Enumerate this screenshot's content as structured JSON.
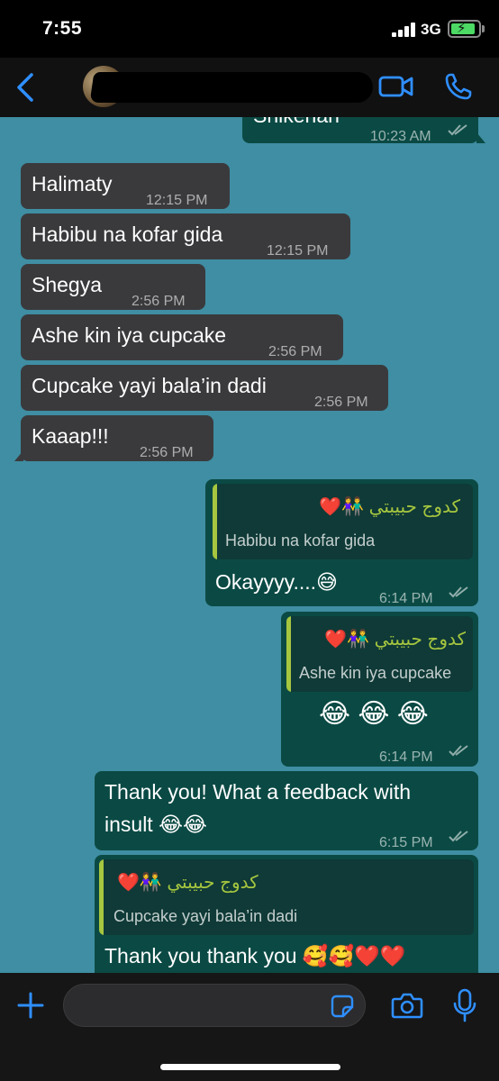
{
  "status_bar": {
    "time": "7:55",
    "network": "3G"
  },
  "colors": {
    "chat_bg": "#3f8ea3",
    "incoming": "#3a3a3d",
    "outgoing": "#0b4a44",
    "accent": "#2f8fff",
    "quote_author": "#a6c63f"
  },
  "nav": {
    "contact_name_redacted": true
  },
  "messages": [
    {
      "direction": "out",
      "text": "Shikenan",
      "time": "10:23 AM",
      "ticks": "read"
    },
    {
      "direction": "in",
      "text": "Halimaty",
      "time": "12:15 PM"
    },
    {
      "direction": "in",
      "text": "Habibu na kofar gida",
      "time": "12:15 PM"
    },
    {
      "direction": "in",
      "text": "Shegya",
      "time": "2:56 PM"
    },
    {
      "direction": "in",
      "text": "Ashe kin iya cupcake",
      "time": "2:56 PM"
    },
    {
      "direction": "in",
      "text": "Cupcake yayi bala’in dadi",
      "time": "2:56 PM"
    },
    {
      "direction": "in",
      "text": "Kaaap!!!",
      "time": "2:56 PM"
    },
    {
      "direction": "out",
      "quote_author": "كدوج حبيبتي 👫❤️",
      "quote_text": "Habibu na kofar gida",
      "text": "Okayyyy....😅",
      "time": "6:14 PM",
      "ticks": "read"
    },
    {
      "direction": "out",
      "quote_author": "كدوج حبيبتي 👫❤️",
      "quote_text": "Ashe kin iya cupcake",
      "text": "😂 😂 😂",
      "time": "6:14 PM",
      "ticks": "read"
    },
    {
      "direction": "out",
      "text_line1": "Thank you! What a feedback with",
      "text_line2": "insult 😂😂",
      "time": "6:15 PM",
      "ticks": "read"
    },
    {
      "direction": "out",
      "quote_author": "كدوج حبيبتي 👫❤️",
      "quote_text": "Cupcake yayi bala’in dadi",
      "text": "Thank you thank you 🥰🥰❤️❤️"
    }
  ],
  "composer": {
    "placeholder": ""
  },
  "icons": {
    "back": "chevron-left-icon",
    "video": "video-camera-icon",
    "call": "phone-icon",
    "plus": "plus-icon",
    "sticker": "sticker-icon",
    "camera": "camera-icon",
    "mic": "microphone-icon"
  }
}
